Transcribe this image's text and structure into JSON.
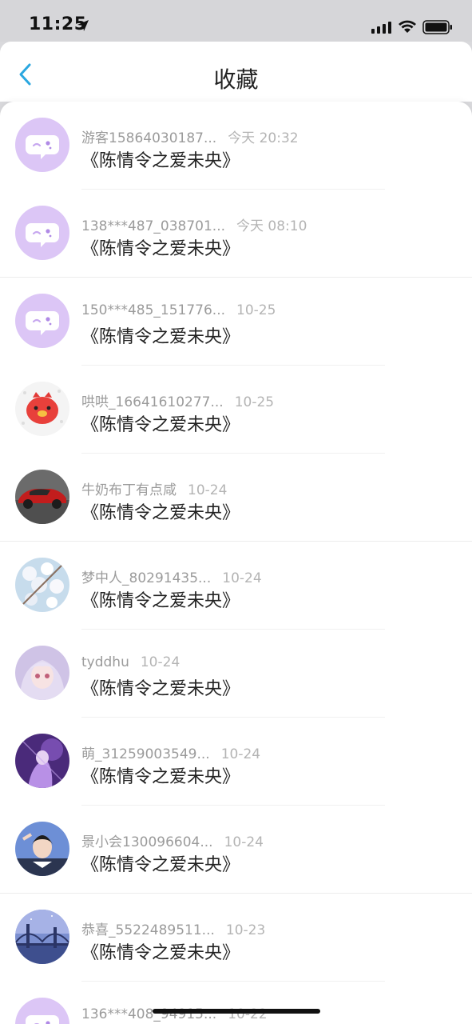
{
  "status_bar": {
    "time": "11:25"
  },
  "nav": {
    "title": "收藏"
  },
  "favorites": [
    {
      "name": "游客15864030187...",
      "time": "今天 20:32",
      "title": "《陈情令之爱未央》",
      "avatar": "default-chat-avatar"
    },
    {
      "name": "138***487_038701...",
      "time": "今天 08:10",
      "title": "《陈情令之爱未央》",
      "avatar": "default-chat-avatar"
    },
    {
      "name": "150***485_151776...",
      "time": "10-25",
      "title": "《陈情令之爱未央》",
      "avatar": "default-chat-avatar"
    },
    {
      "name": "哄哄_16641610277...",
      "time": "10-25",
      "title": "《陈情令之爱未央》",
      "avatar": "red-pig-avatar"
    },
    {
      "name": "牛奶布丁有点咸",
      "time": "10-24",
      "title": "《陈情令之爱未央》",
      "avatar": "red-car-photo-avatar"
    },
    {
      "name": "梦中人_80291435...",
      "time": "10-24",
      "title": "《陈情令之爱未央》",
      "avatar": "blossom-photo-avatar"
    },
    {
      "name": "tyddhu",
      "time": "10-24",
      "title": "《陈情令之爱未央》",
      "avatar": "anime-girl-avatar"
    },
    {
      "name": "萌_31259003549...",
      "time": "10-24",
      "title": "《陈情令之爱未央》",
      "avatar": "purple-art-avatar"
    },
    {
      "name": "景小会130096604...",
      "time": "10-24",
      "title": "《陈情令之爱未央》",
      "avatar": "girl-photo-avatar"
    },
    {
      "name": "恭喜_5522489511...",
      "time": "10-23",
      "title": "《陈情令之爱未央》",
      "avatar": "bridge-night-avatar"
    },
    {
      "name": "136***408_94915...",
      "time": "10-22",
      "title": "",
      "avatar": "default-chat-avatar"
    }
  ],
  "colors": {
    "accent": "#2aa7e0",
    "default_avatar": "#d9c2f5"
  }
}
